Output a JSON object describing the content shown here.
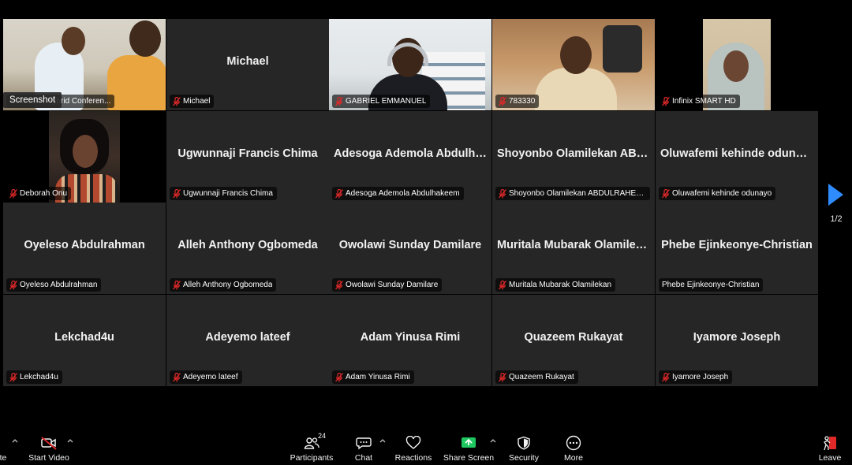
{
  "screenshot_tag": "Screenshot",
  "tiles": [
    {
      "row": 0,
      "col": 0,
      "kind": "video",
      "scene": "room1",
      "label": "Education Hybrid Conferen...",
      "active": true,
      "muted": false,
      "big_name": ""
    },
    {
      "row": 0,
      "col": 1,
      "kind": "name",
      "label": "Michael",
      "muted": true,
      "big_name": "Michael"
    },
    {
      "row": 0,
      "col": 2,
      "kind": "video",
      "scene": "lib",
      "label": "GABRIEL EMMANUEL",
      "muted": true,
      "big_name": ""
    },
    {
      "row": 0,
      "col": 3,
      "kind": "video",
      "scene": "office",
      "label": "783330",
      "muted": true,
      "big_name": ""
    },
    {
      "row": 0,
      "col": 4,
      "kind": "video",
      "scene": "hijab",
      "label": "Infinix SMART HD",
      "muted": true,
      "big_name": ""
    },
    {
      "row": 1,
      "col": 0,
      "kind": "video",
      "scene": "dark",
      "label": "Deborah Onu",
      "muted": true,
      "big_name": ""
    },
    {
      "row": 1,
      "col": 1,
      "kind": "name",
      "label": "Ugwunnaji Francis Chima",
      "muted": true,
      "big_name": "Ugwunnaji Francis Chima"
    },
    {
      "row": 1,
      "col": 2,
      "kind": "name",
      "label": "Adesoga Ademola Abdulhakeem",
      "muted": true,
      "big_name": "Adesoga Ademola Abdulha..."
    },
    {
      "row": 1,
      "col": 3,
      "kind": "name",
      "label": "Shoyonbo Olamilekan ABDULRAHEEM",
      "muted": true,
      "big_name": "Shoyonbo Olamilekan ABD..."
    },
    {
      "row": 1,
      "col": 4,
      "kind": "name",
      "label": "Oluwafemi kehinde odunayo",
      "muted": true,
      "big_name": "Oluwafemi kehinde odunayo"
    },
    {
      "row": 2,
      "col": 0,
      "kind": "name",
      "label": "Oyeleso Abdulrahman",
      "muted": true,
      "big_name": "Oyeleso Abdulrahman"
    },
    {
      "row": 2,
      "col": 1,
      "kind": "name",
      "label": "Alleh Anthony Ogbomeda",
      "muted": true,
      "big_name": "Alleh Anthony Ogbomeda"
    },
    {
      "row": 2,
      "col": 2,
      "kind": "name",
      "label": "Owolawi Sunday Damilare",
      "muted": true,
      "big_name": "Owolawi Sunday Damilare"
    },
    {
      "row": 2,
      "col": 3,
      "kind": "name",
      "label": "Muritala Mubarak Olamilekan",
      "muted": true,
      "big_name": "Muritala Mubarak Olamilekan"
    },
    {
      "row": 2,
      "col": 4,
      "kind": "name",
      "label": "Phebe Ejinkeonye-Christian",
      "muted": false,
      "big_name": "Phebe Ejinkeonye-Christian"
    },
    {
      "row": 3,
      "col": 0,
      "kind": "name",
      "label": "Lekchad4u",
      "muted": true,
      "big_name": "Lekchad4u"
    },
    {
      "row": 3,
      "col": 1,
      "kind": "name",
      "label": "Adeyemo lateef",
      "muted": true,
      "big_name": "Adeyemo lateef"
    },
    {
      "row": 3,
      "col": 2,
      "kind": "name",
      "label": "Adam Yinusa Rimi",
      "muted": true,
      "big_name": "Adam Yinusa Rimi"
    },
    {
      "row": 3,
      "col": 3,
      "kind": "name",
      "label": "Quazeem Rukayat",
      "muted": true,
      "big_name": "Quazeem Rukayat"
    },
    {
      "row": 3,
      "col": 4,
      "kind": "name",
      "label": "Iyamore Joseph",
      "muted": true,
      "big_name": "Iyamore Joseph"
    }
  ],
  "pager": {
    "page_indicator": "1/2",
    "next_icon": "play-triangle-icon"
  },
  "toolbar": {
    "unmute_label": "te",
    "start_video_label": "Start Video",
    "participants_label": "Participants",
    "participants_count": "24",
    "chat_label": "Chat",
    "reactions_label": "Reactions",
    "share_screen_label": "Share Screen",
    "security_label": "Security",
    "more_label": "More",
    "leave_label": "Leave"
  },
  "colors": {
    "tile_bg": "#262626",
    "active_border": "#d8e84a",
    "muted_red": "#e02828",
    "share_green": "#1ec760",
    "pager_blue": "#2f8cff"
  }
}
